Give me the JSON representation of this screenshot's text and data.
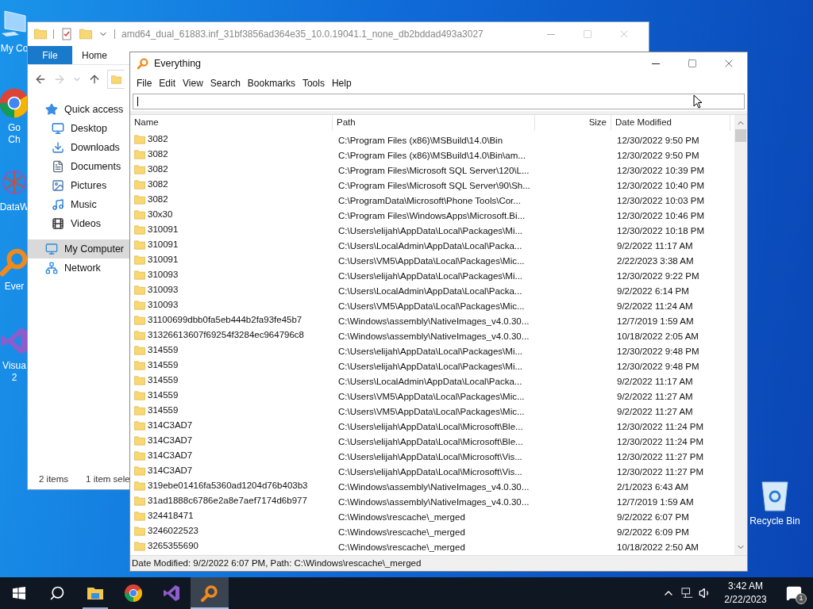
{
  "desktop_icons": [
    {
      "kind": "computer",
      "lines": [
        "My Co"
      ]
    },
    {
      "kind": "chrome",
      "lines": [
        "Go",
        "Ch"
      ]
    },
    {
      "kind": "network-graph",
      "lines": [
        "DataW"
      ]
    },
    {
      "kind": "magnifier",
      "lines": [
        "Ever"
      ]
    },
    {
      "kind": "studio",
      "lines": [
        "Visua",
        "2"
      ]
    }
  ],
  "recycle_bin": {
    "label": "Recycle Bin"
  },
  "explorer": {
    "title": "amd64_dual_61883.inf_31bf3856ad364e35_10.0.19041.1_none_db2bddad493a3027",
    "ribbon_tabs": [
      {
        "label": "File",
        "selected": true
      },
      {
        "label": "Home",
        "selected": false
      }
    ],
    "nav_items": [
      {
        "label": "Quick access",
        "kind": "star",
        "selected": false,
        "children": [
          {
            "label": "Desktop",
            "kind": "desktop",
            "selected": false
          },
          {
            "label": "Downloads",
            "kind": "download",
            "selected": false
          },
          {
            "label": "Documents",
            "kind": "document",
            "selected": false
          },
          {
            "label": "Pictures",
            "kind": "picture",
            "selected": false
          },
          {
            "label": "Music",
            "kind": "music",
            "selected": false
          },
          {
            "label": "Videos",
            "kind": "video",
            "selected": false
          }
        ]
      },
      {
        "label": "My Computer",
        "kind": "computer",
        "selected": true
      },
      {
        "label": "Network",
        "kind": "network",
        "selected": false
      }
    ],
    "status": [
      "2 items",
      "1 item sele"
    ]
  },
  "everything": {
    "title": "Everything",
    "menu": [
      "File",
      "Edit",
      "View",
      "Search",
      "Bookmarks",
      "Tools",
      "Help"
    ],
    "columns": [
      "Name",
      "Path",
      "Size",
      "Date Modified"
    ],
    "rows": [
      {
        "name": "3082",
        "path": "C:\\Program Files (x86)\\MSBuild\\14.0\\Bin",
        "date": "12/30/2022 9:50 PM"
      },
      {
        "name": "3082",
        "path": "C:\\Program Files (x86)\\MSBuild\\14.0\\Bin\\am...",
        "date": "12/30/2022 9:50 PM"
      },
      {
        "name": "3082",
        "path": "C:\\Program Files\\Microsoft SQL Server\\120\\L...",
        "date": "12/30/2022 10:39 PM"
      },
      {
        "name": "3082",
        "path": "C:\\Program Files\\Microsoft SQL Server\\90\\Sh...",
        "date": "12/30/2022 10:40 PM"
      },
      {
        "name": "3082",
        "path": "C:\\ProgramData\\Microsoft\\Phone Tools\\Cor...",
        "date": "12/30/2022 10:03 PM"
      },
      {
        "name": "30x30",
        "path": "C:\\Program Files\\WindowsApps\\Microsoft.Bi...",
        "date": "12/30/2022 10:46 PM"
      },
      {
        "name": "310091",
        "path": "C:\\Users\\elijah\\AppData\\Local\\Packages\\Mi...",
        "date": "12/30/2022 10:18 PM"
      },
      {
        "name": "310091",
        "path": "C:\\Users\\LocalAdmin\\AppData\\Local\\Packa...",
        "date": "9/2/2022 11:17 AM"
      },
      {
        "name": "310091",
        "path": "C:\\Users\\VM5\\AppData\\Local\\Packages\\Mic...",
        "date": "2/22/2023 3:38 AM"
      },
      {
        "name": "310093",
        "path": "C:\\Users\\elijah\\AppData\\Local\\Packages\\Mi...",
        "date": "12/30/2022 9:22 PM"
      },
      {
        "name": "310093",
        "path": "C:\\Users\\LocalAdmin\\AppData\\Local\\Packa...",
        "date": "9/2/2022 6:14 PM"
      },
      {
        "name": "310093",
        "path": "C:\\Users\\VM5\\AppData\\Local\\Packages\\Mic...",
        "date": "9/2/2022 11:24 AM"
      },
      {
        "name": "31100699dbb0fa5eb444b2fa93fe45b7",
        "path": "C:\\Windows\\assembly\\NativeImages_v4.0.30...",
        "date": "12/7/2019 1:59 AM"
      },
      {
        "name": "31326613607f69254f3284ec964796c8",
        "path": "C:\\Windows\\assembly\\NativeImages_v4.0.30...",
        "date": "10/18/2022 2:05 AM"
      },
      {
        "name": "314559",
        "path": "C:\\Users\\elijah\\AppData\\Local\\Packages\\Mi...",
        "date": "12/30/2022 9:48 PM"
      },
      {
        "name": "314559",
        "path": "C:\\Users\\elijah\\AppData\\Local\\Packages\\Mi...",
        "date": "12/30/2022 9:48 PM"
      },
      {
        "name": "314559",
        "path": "C:\\Users\\LocalAdmin\\AppData\\Local\\Packa...",
        "date": "9/2/2022 11:17 AM"
      },
      {
        "name": "314559",
        "path": "C:\\Users\\VM5\\AppData\\Local\\Packages\\Mic...",
        "date": "9/2/2022 11:27 AM"
      },
      {
        "name": "314559",
        "path": "C:\\Users\\VM5\\AppData\\Local\\Packages\\Mic...",
        "date": "9/2/2022 11:27 AM"
      },
      {
        "name": "314C3AD7",
        "path": "C:\\Users\\elijah\\AppData\\Local\\Microsoft\\Ble...",
        "date": "12/30/2022 11:24 PM"
      },
      {
        "name": "314C3AD7",
        "path": "C:\\Users\\elijah\\AppData\\Local\\Microsoft\\Ble...",
        "date": "12/30/2022 11:24 PM"
      },
      {
        "name": "314C3AD7",
        "path": "C:\\Users\\elijah\\AppData\\Local\\Microsoft\\Vis...",
        "date": "12/30/2022 11:27 PM"
      },
      {
        "name": "314C3AD7",
        "path": "C:\\Users\\elijah\\AppData\\Local\\Microsoft\\Vis...",
        "date": "12/30/2022 11:27 PM"
      },
      {
        "name": "319ebe01416fa5360ad1204d76b403b3",
        "path": "C:\\Windows\\assembly\\NativeImages_v4.0.30...",
        "date": "2/1/2023 6:43 AM"
      },
      {
        "name": "31ad1888c6786e2a8e7aef7174d6b977",
        "path": "C:\\Windows\\assembly\\NativeImages_v4.0.30...",
        "date": "12/7/2019 1:59 AM"
      },
      {
        "name": "324418471",
        "path": "C:\\Windows\\rescache\\_merged",
        "date": "9/2/2022 6:07 PM"
      },
      {
        "name": "3246022523",
        "path": "C:\\Windows\\rescache\\_merged",
        "date": "9/2/2022 6:09 PM"
      },
      {
        "name": "3265355690",
        "path": "C:\\Windows\\rescache\\_merged",
        "date": "10/18/2022 2:50 AM"
      }
    ],
    "status": "Date Modified: 9/2/2022 6:07 PM, Path: C:\\Windows\\rescache\\_merged"
  },
  "taskbar": {
    "apps": [
      {
        "kind": "explorer",
        "running": true,
        "selected": false
      },
      {
        "kind": "chrome",
        "running": false,
        "selected": false
      },
      {
        "kind": "studio",
        "running": false,
        "selected": false
      },
      {
        "kind": "magnifier",
        "running": true,
        "selected": true
      }
    ],
    "clock": {
      "time": "3:42 AM",
      "date": "2/22/2023"
    },
    "notifications": "1"
  }
}
